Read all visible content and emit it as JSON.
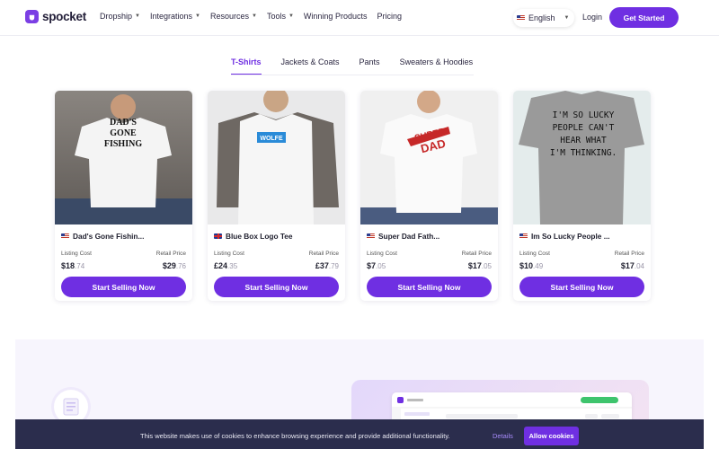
{
  "header": {
    "logo_text": "spocket",
    "nav": [
      {
        "label": "Dropship",
        "dropdown": true
      },
      {
        "label": "Integrations",
        "dropdown": true
      },
      {
        "label": "Resources",
        "dropdown": true
      },
      {
        "label": "Tools",
        "dropdown": true
      },
      {
        "label": "Winning Products",
        "dropdown": false
      },
      {
        "label": "Pricing",
        "dropdown": false
      }
    ],
    "language": "English",
    "login": "Login",
    "get_started": "Get Started"
  },
  "tabs": [
    {
      "label": "T-Shirts",
      "active": true
    },
    {
      "label": "Jackets & Coats",
      "active": false
    },
    {
      "label": "Pants",
      "active": false
    },
    {
      "label": "Sweaters & Hoodies",
      "active": false
    }
  ],
  "products": [
    {
      "title": "Dad's Gone Fishin...",
      "flag": "us",
      "listing_label": "Listing Cost",
      "retail_label": "Retail Price",
      "listing_main": "$18",
      "listing_cents": ".74",
      "retail_main": "$29",
      "retail_cents": ".76",
      "button": "Start Selling Now",
      "shirt_text": "DAD'S GONE FISHING",
      "shirt_color": "#f4f4f4"
    },
    {
      "title": "Blue Box Logo Tee",
      "flag": "uk",
      "listing_label": "Listing Cost",
      "retail_label": "Retail Price",
      "listing_main": "£24",
      "listing_cents": ".35",
      "retail_main": "£37",
      "retail_cents": ".79",
      "button": "Start Selling Now",
      "shirt_text": "WOLFE",
      "shirt_color": "#f6f6f6"
    },
    {
      "title": "Super Dad Fath...",
      "flag": "us",
      "listing_label": "Listing Cost",
      "retail_label": "Retail Price",
      "listing_main": "$7",
      "listing_cents": ".05",
      "retail_main": "$17",
      "retail_cents": ".05",
      "button": "Start Selling Now",
      "shirt_text": "SUPER DAD",
      "shirt_color": "#f5f5f5"
    },
    {
      "title": "Im So Lucky People ...",
      "flag": "us",
      "listing_label": "Listing Cost",
      "retail_label": "Retail Price",
      "listing_main": "$10",
      "listing_cents": ".49",
      "retail_main": "$17",
      "retail_cents": ".04",
      "button": "Start Selling Now",
      "shirt_text": "I'M SO LUCKY PEOPLE CAN'T HEAR WHAT I'M THINKING.",
      "shirt_color": "#9a9a9a"
    }
  ],
  "cookie": {
    "text": "This website makes use of cookies to enhance browsing experience and provide additional functionality.",
    "details": "Details",
    "allow": "Allow cookies"
  },
  "colors": {
    "brand": "#6f2fe2",
    "cookie_bg": "#2b2d4d"
  }
}
